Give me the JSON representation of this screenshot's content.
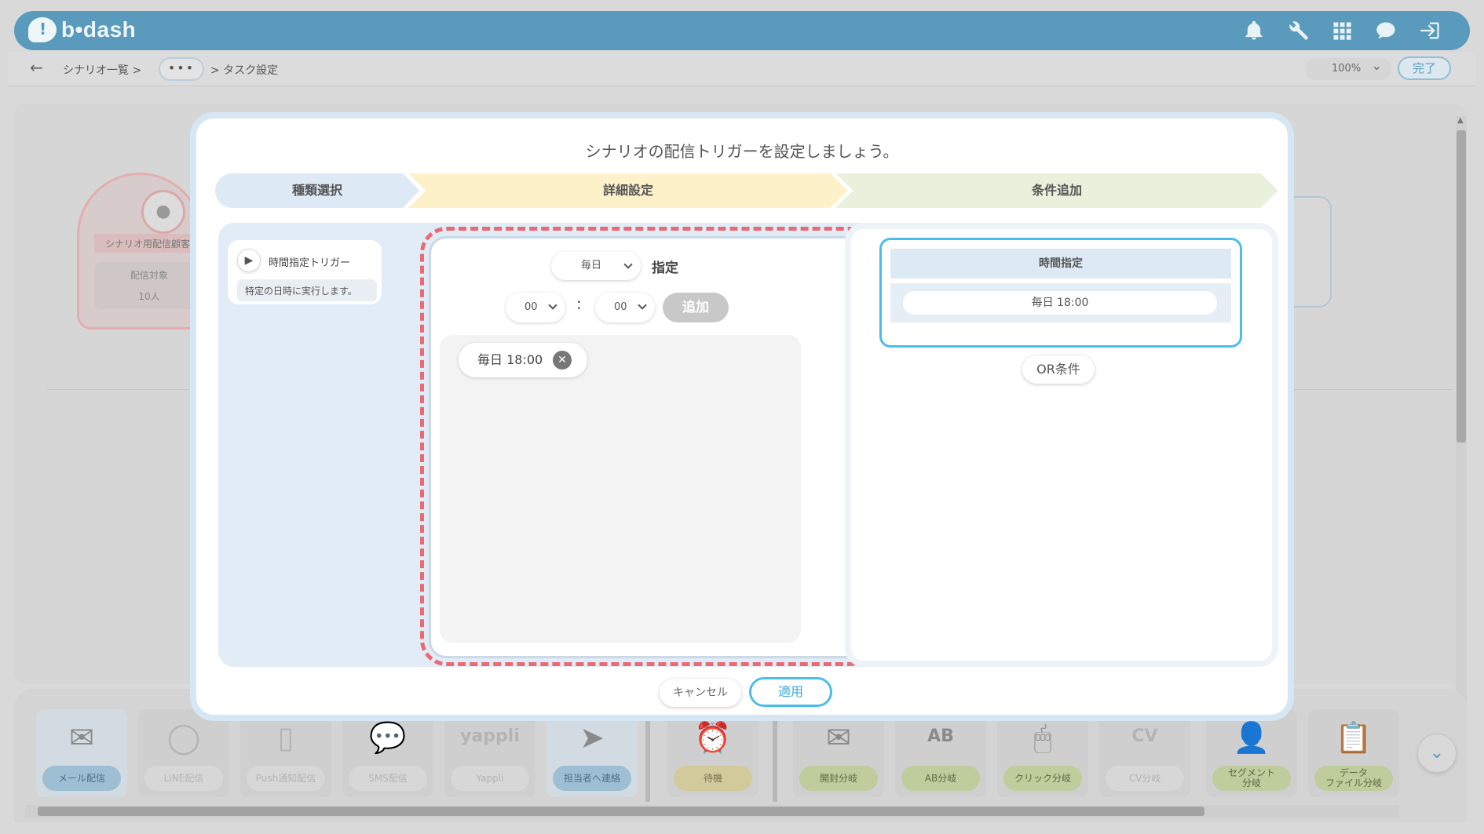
{
  "header": {
    "logo_text": "b•dash",
    "icons": [
      "bell-icon",
      "wrench-icon",
      "apps-grid-icon",
      "chat-bubble-icon",
      "logout-icon"
    ],
    "colors": {
      "bar": "#5a9bbd"
    }
  },
  "breadcrumb": {
    "scenario_list": "シナリオ一覧 >",
    "ellipsis": "•••",
    "current": "> タスク設定"
  },
  "zoom": {
    "value": "100%"
  },
  "done_label": "完了",
  "background_node": {
    "label": "シナリオ用配信顧客",
    "target_label": "配信対象",
    "count": "10人"
  },
  "modal": {
    "title": "シナリオの配信トリガーを設定しましょう。",
    "steps": [
      {
        "label": "種類選択",
        "color": "#dde9f4"
      },
      {
        "label": "詳細設定",
        "color": "#fcf1c9"
      },
      {
        "label": "条件追加",
        "color": "#e9f0dc"
      }
    ],
    "trigger": {
      "name": "時間指定トリガー",
      "description": "特定の日時に実行します。"
    },
    "detail": {
      "frequency": "毎日",
      "designate_label": "指定",
      "hour": "00",
      "colon": ":",
      "minute": "00",
      "add_label": "追加",
      "chips": [
        "毎日 18:00"
      ],
      "remove_glyph": "✕"
    },
    "conditions": {
      "header": "時間指定",
      "value": "毎日 18:00",
      "or_label": "OR条件"
    },
    "cancel_label": "キャンセル",
    "apply_label": "適用",
    "colors": {
      "highlight_dash": "#ea6a74",
      "accent": "#4bbde8"
    }
  },
  "toolbox": {
    "items": [
      {
        "label": "メール配信",
        "icon": "envelope-icon"
      },
      {
        "label": "LINE配信",
        "icon": "line-icon"
      },
      {
        "label": "Push通知配信",
        "icon": "push-phone-icon"
      },
      {
        "label": "SMS配信",
        "icon": "sms-bubble-icon"
      },
      {
        "label": "Yappli",
        "icon": "yappli-icon",
        "icon_text": "yappli"
      },
      {
        "label": "担当者へ連絡",
        "icon": "paper-plane-icon"
      },
      {
        "label": "待機",
        "icon": "alarm-clock-icon"
      },
      {
        "label": "開封分岐",
        "icon": "open-envelope-icon"
      },
      {
        "label": "AB分岐",
        "icon": "ab-icon",
        "icon_text": "AB"
      },
      {
        "label": "クリック分岐",
        "icon": "mouse-icon"
      },
      {
        "label": "CV分岐",
        "icon": "cv-search-icon",
        "icon_text": "CV"
      },
      {
        "label": "セグメント\n分岐",
        "icon": "segment-portrait-icon"
      },
      {
        "label": "データ\nファイル分岐",
        "icon": "clipboard-icon"
      }
    ]
  }
}
